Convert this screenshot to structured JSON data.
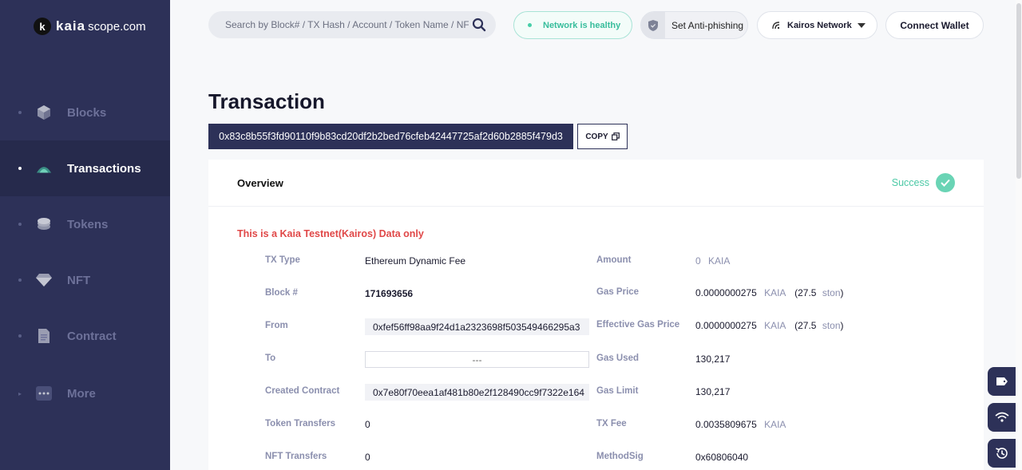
{
  "brand": {
    "mark": "k",
    "name": "kaia",
    "domain": "scope.com"
  },
  "sidebar": {
    "items": [
      {
        "label": "Blocks",
        "icon": "cube-icon",
        "active": false
      },
      {
        "label": "Transactions",
        "icon": "transaction-icon",
        "active": true
      },
      {
        "label": "Tokens",
        "icon": "coins-icon",
        "active": false
      },
      {
        "label": "NFT",
        "icon": "diamond-icon",
        "active": false
      },
      {
        "label": "Contract",
        "icon": "document-icon",
        "active": false
      },
      {
        "label": "More",
        "icon": "more-dots-icon",
        "active": false
      }
    ]
  },
  "topbar": {
    "search_placeholder": "Search by Block# / TX Hash / Account / Token Name / NFT",
    "health": "Network is healthy",
    "antiphishing": "Set Anti-phishing",
    "network": "Kairos Network",
    "connect": "Connect Wallet"
  },
  "page": {
    "title": "Transaction",
    "hash": "0x83c8b55f3fd90110f9b83cd20df2b2bed76cfeb42447725af2d60b2885f479d3",
    "copy": "COPY"
  },
  "overview": {
    "title": "Overview",
    "status": "Success",
    "notice": "This is a Kaia Testnet(Kairos) Data only",
    "left": {
      "tx_type_label": "TX Type",
      "tx_type": "Ethereum Dynamic Fee",
      "block_label": "Block #",
      "block": "171693656",
      "from_label": "From",
      "from": "0xfef56ff98aa9f24d1a2323698f503549466295a3",
      "to_label": "To",
      "to": "---",
      "created_label": "Created Contract",
      "created": "0x7e80f70eea1af481b80e2f128490cc9f7322e164",
      "token_transfers_label": "Token Transfers",
      "token_transfers": "0",
      "nft_transfers_label": "NFT Transfers",
      "nft_transfers": "0"
    },
    "right": {
      "amount_label": "Amount",
      "amount": "0",
      "amount_unit": "KAIA",
      "gas_price_label": "Gas Price",
      "gas_price": "0.0000000275",
      "gas_price_unit": "KAIA",
      "gas_price_ston": "27.5",
      "ston": "ston",
      "eff_gas_price_label": "Effective Gas Price",
      "eff_gas_price": "0.0000000275",
      "eff_gas_price_unit": "KAIA",
      "eff_gas_price_ston": "27.5",
      "gas_used_label": "Gas Used",
      "gas_used": "130,217",
      "gas_limit_label": "Gas Limit",
      "gas_limit": "130,217",
      "tx_fee_label": "TX Fee",
      "tx_fee": "0.0035809675",
      "tx_fee_unit": "KAIA",
      "method_label": "MethodSig",
      "method": "0x60806040"
    }
  },
  "colors": {
    "sidebar": "#2d3158",
    "success": "#4cc9a6",
    "error": "#e04848"
  }
}
